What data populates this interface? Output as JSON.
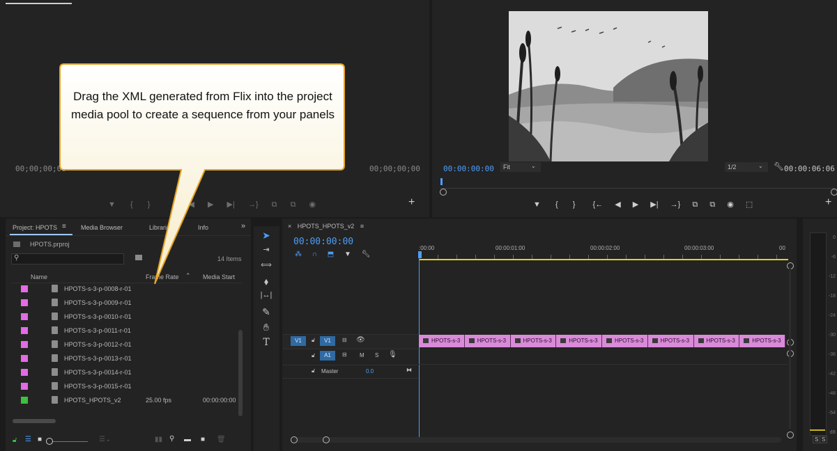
{
  "source_monitor": {
    "timecode_left": "00;00;00;00",
    "timecode_right": "00;00;00;00",
    "transport": [
      "▼",
      "{",
      "}",
      "{←",
      "◀",
      "▶",
      "▶|",
      "→}",
      "⧉",
      "⧉",
      "◉"
    ],
    "add": "+"
  },
  "callout": {
    "text": "Drag the XML generated from Flix into the project media pool to create a sequence from your panels"
  },
  "program_monitor": {
    "timecode": "00:00:00:00",
    "fit": "Fit",
    "resolution": "1/2",
    "duration": "00:00:06:06",
    "transport": [
      "▼",
      "{",
      "}",
      "{←",
      "◀",
      "▶",
      "▶|",
      "→}",
      "⧉",
      "⧉",
      "◉",
      "⬚"
    ],
    "add": "+"
  },
  "project": {
    "tabs": [
      "Project: HPOTS",
      "Media Browser",
      "Librarie",
      "Info"
    ],
    "more": "»",
    "file": "HPOTS.prproj",
    "search_placeholder": "",
    "count": "14 Items",
    "columns": {
      "name": "Name",
      "frame_rate": "Frame Rate",
      "media_start": "Media Start"
    },
    "items": [
      {
        "name": "HPOTS-s-3-p-0008-r-01",
        "color": "#e36be3",
        "fps": "",
        "start": ""
      },
      {
        "name": "HPOTS-s-3-p-0009-r-01",
        "color": "#e36be3",
        "fps": "",
        "start": ""
      },
      {
        "name": "HPOTS-s-3-p-0010-r-01",
        "color": "#e36be3",
        "fps": "",
        "start": ""
      },
      {
        "name": "HPOTS-s-3-p-0011-r-01",
        "color": "#e36be3",
        "fps": "",
        "start": ""
      },
      {
        "name": "HPOTS-s-3-p-0012-r-01",
        "color": "#e36be3",
        "fps": "",
        "start": ""
      },
      {
        "name": "HPOTS-s-3-p-0013-r-01",
        "color": "#e36be3",
        "fps": "",
        "start": ""
      },
      {
        "name": "HPOTS-s-3-p-0014-r-01",
        "color": "#e36be3",
        "fps": "",
        "start": ""
      },
      {
        "name": "HPOTS-s-3-p-0015-r-01",
        "color": "#e36be3",
        "fps": "",
        "start": ""
      },
      {
        "name": "HPOTS_HPOTS_v2",
        "color": "#3fbf3f",
        "fps": "25.00 fps",
        "start": "00:00:00:00"
      }
    ]
  },
  "timeline": {
    "tab": "HPOTS_HPOTS_v2",
    "close": "×",
    "menu": "≡",
    "timecode": "00:00:00:00",
    "ruler": [
      ":00:00",
      "00:00:01:00",
      "00:00:02:00",
      "00:00:03:00",
      "00"
    ],
    "tracks": {
      "v1_src": "V1",
      "v1": "V1",
      "a1": "A1",
      "m": "M",
      "s": "S",
      "master": "Master",
      "master_val": "0.0"
    },
    "clip_label": "HPOTS-s-3",
    "clip_count": 8
  },
  "meter": {
    "ticks": [
      "0",
      "-6",
      "-12",
      "-18",
      "-24",
      "-30",
      "-36",
      "-42",
      "-48",
      "-54",
      "dB"
    ],
    "solo": [
      "S",
      "S"
    ]
  },
  "colors": {
    "accent": "#4d9ef7",
    "clip": "#d98ad8",
    "sequence": "#3fbf3f",
    "playhead": "#4d9ef7",
    "workarea": "#e6d21a"
  }
}
